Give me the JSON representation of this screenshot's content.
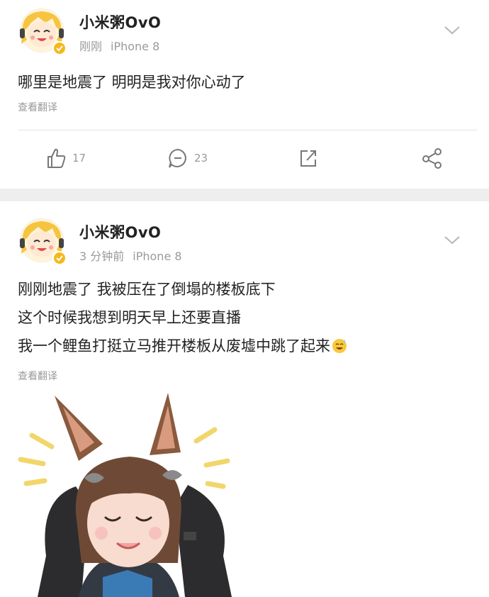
{
  "posts": [
    {
      "username": "小米粥OvO",
      "time": "刚刚",
      "device": "iPhone 8",
      "lines": [
        "哪里是地震了 明明是我对你心动了"
      ],
      "translate": "查看翻译",
      "likes": "17",
      "comments": "23"
    },
    {
      "username": "小米粥OvO",
      "time": "3 分钟前",
      "device": "iPhone 8",
      "lines": [
        "刚刚地震了 我被压在了倒塌的楼板底下",
        "这个时候我想到明天早上还要直播",
        "我一个鲤鱼打挺立马推开楼板从废墟中跳了起来"
      ],
      "translate": "查看翻译"
    }
  ],
  "icons": {
    "like": "thumbs-up-icon",
    "comment": "comment-icon",
    "repost": "repost-icon",
    "share": "share-icon",
    "more": "chevron-down-icon",
    "verified": "verified-badge-icon",
    "emoji": "sweat-smile-emoji"
  },
  "colors": {
    "text": "#222222",
    "muted": "#9a9a9a",
    "separator": "#eeeeee",
    "badge": "#f5b81c"
  }
}
